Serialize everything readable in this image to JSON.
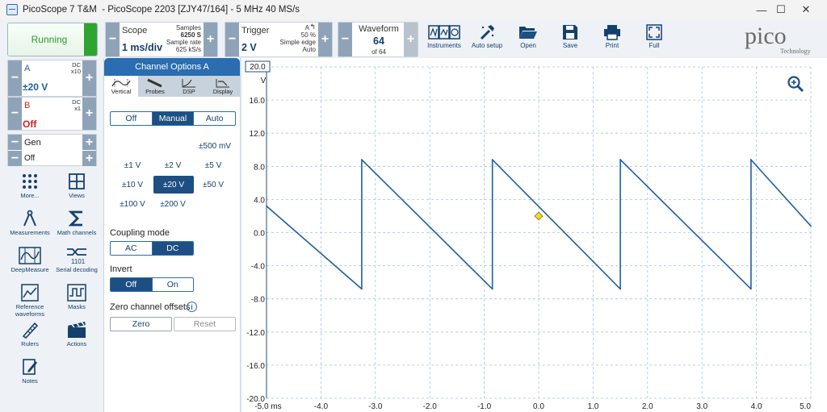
{
  "window": {
    "title": "PicoScope 7 T&M  - PicoScope 2203 [ZJY47/164] - 5 MHz 40 MS/s",
    "minimize": "—",
    "maximize": "☐",
    "close": "✕"
  },
  "run_state": "Running",
  "scope_ctl": {
    "label": "Scope",
    "timebase": "1 ms/div",
    "samples_label": "Samples",
    "samples": "6250 S",
    "rate_label": "Sample rate",
    "rate": "625 kS/s"
  },
  "trigger_ctl": {
    "label": "Trigger",
    "level": "2 V",
    "source": "A",
    "percent": "50 %",
    "type": "Simple edge",
    "mode": "Auto"
  },
  "waveform_ctl": {
    "label": "Waveform",
    "current": "64",
    "of": "of 64"
  },
  "toolbar": [
    {
      "label": "Instruments",
      "icon": "instruments-icon"
    },
    {
      "label": "Auto setup",
      "icon": "auto-setup-icon"
    },
    {
      "label": "Open",
      "icon": "folder-open-icon"
    },
    {
      "label": "Save",
      "icon": "save-icon"
    },
    {
      "label": "Print",
      "icon": "print-icon"
    },
    {
      "label": "Full",
      "icon": "fullscreen-icon"
    }
  ],
  "logo": {
    "name": "pico",
    "sub": "Technology"
  },
  "channels": [
    {
      "name": "A",
      "range": "±20 V",
      "coupling": "DC",
      "probe": "x10",
      "color": "#1f5fa0"
    },
    {
      "name": "B",
      "range": "Off",
      "coupling": "DC",
      "probe": "x1",
      "color": "#d42020"
    },
    {
      "name": "Gen",
      "range": "Off"
    }
  ],
  "tools": [
    {
      "label": "More...",
      "icon": "more-dots-icon"
    },
    {
      "label": "Views",
      "icon": "views-grid-icon"
    },
    {
      "label": "Measurements",
      "icon": "measurements-icon"
    },
    {
      "label": "Math channels",
      "icon": "sigma-icon"
    },
    {
      "label": "DeepMeasure",
      "icon": "deepmeasure-icon"
    },
    {
      "label": "Serial decoding",
      "icon": "serial-decoding-icon"
    },
    {
      "label": "Reference waveforms",
      "icon": "reference-waveforms-icon"
    },
    {
      "label": "Masks",
      "icon": "masks-icon"
    },
    {
      "label": "Rulers",
      "icon": "rulers-icon"
    },
    {
      "label": "Actions",
      "icon": "actions-clapper-icon"
    },
    {
      "label": "Notes",
      "icon": "notes-icon"
    }
  ],
  "panel": {
    "title": "Channel Options A",
    "tabs": [
      "Vertical",
      "Probes",
      "DSP",
      "Display"
    ],
    "range_mode": [
      "Off",
      "Manual",
      "Auto"
    ],
    "range_mode_selected": "Manual",
    "ranges": [
      "±500 mV",
      "±1 V",
      "±2 V",
      "±5 V",
      "±10 V",
      "±20 V",
      "±50 V",
      "±100 V",
      "±200 V"
    ],
    "range_selected": "±20 V",
    "coupling_label": "Coupling mode",
    "coupling": [
      "AC",
      "DC"
    ],
    "coupling_selected": "DC",
    "invert_label": "Invert",
    "invert": [
      "Off",
      "On"
    ],
    "invert_selected": "Off",
    "zero_label": "Zero channel offsets",
    "zero_btn": "Zero",
    "reset_btn": "Reset"
  },
  "chart_data": {
    "type": "line",
    "x_unit": "ms",
    "y_unit": "V",
    "xlim": [
      -5.0,
      5.0
    ],
    "ylim": [
      -20.0,
      20.0
    ],
    "x_ticks": [
      "-5.0 ms",
      "-4.0",
      "-3.0",
      "-2.0",
      "-1.0",
      "0.0",
      "1.0",
      "2.0",
      "3.0",
      "4.0",
      "5.0"
    ],
    "y_ticks": [
      "20.0",
      "16.0",
      "12.0",
      "8.0",
      "4.0",
      "0.0",
      "-4.0",
      "-8.0",
      "-12.0",
      "-16.0",
      "-20.0"
    ],
    "grid": true,
    "series": [
      {
        "color": "#1f5fa0",
        "x": [
          -5.0,
          -3.25,
          -3.25,
          -0.85,
          -0.85,
          1.5,
          1.5,
          3.9,
          3.9,
          5.0
        ],
        "y": [
          3.2,
          -6.8,
          8.8,
          -6.8,
          8.8,
          -6.8,
          8.8,
          -6.8,
          8.8,
          0.8
        ]
      }
    ],
    "trigger_marker": {
      "x": 0.0,
      "y": 2.0
    },
    "y_scale_box": "20.0",
    "y_scale_unit": "V"
  }
}
